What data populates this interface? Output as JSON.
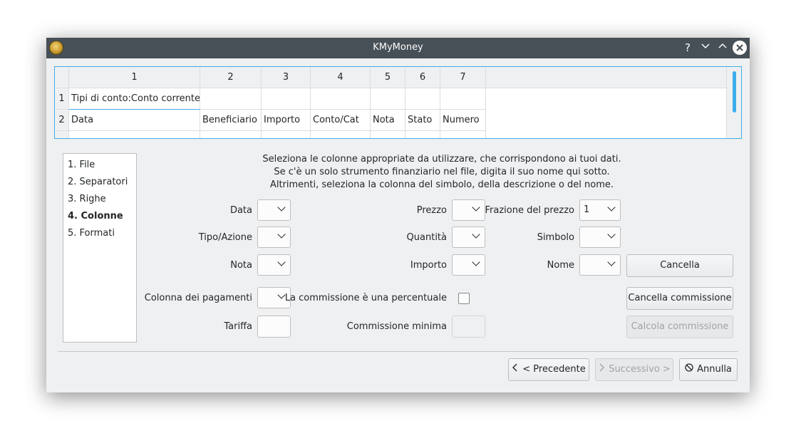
{
  "window": {
    "title": "KMyMoney"
  },
  "titlebar": {
    "help": "?",
    "minimize": "⌄",
    "maximize": "⌃",
    "close": "✕"
  },
  "preview": {
    "col_headers": [
      "1",
      "2",
      "3",
      "4",
      "5",
      "6",
      "7"
    ],
    "rows": [
      {
        "num": "1",
        "cells": [
          "Tipi di conto:Conto corrente",
          "",
          "",
          "",
          "",
          "",
          ""
        ]
      },
      {
        "num": "2",
        "cells": [
          "Data",
          "Beneficiario",
          "Importo",
          "Conto/Cat",
          "Nota",
          "Stato",
          "Numero"
        ]
      }
    ]
  },
  "steps": {
    "items": [
      "1. File",
      "2. Separatori",
      "3. Righe",
      "4. Colonne",
      "5. Formati"
    ],
    "active_index": 3
  },
  "info": {
    "line1": "Seleziona le colonne appropriate da utilizzare, che corrispondono ai tuoi dati.",
    "line2": "Se c'è un solo strumento finanziario nel file, digita il suo nome qui sotto.",
    "line3": "Altrimenti, seleziona la colonna del simbolo, della descrizione o del nome."
  },
  "form": {
    "data_label": "Data",
    "tipo_label": "Tipo/Azione",
    "nota_label": "Nota",
    "colonna_pagamenti_label": "Colonna dei pagamenti",
    "tariffa_label": "Tariffa",
    "prezzo_label": "Prezzo",
    "quantita_label": "Quantità",
    "importo_label": "Importo",
    "percentuale_label": "La commissione è una percentuale",
    "commissione_minima_label": "Commissione minima",
    "frazione_label": "Frazione del prezzo",
    "frazione_value": "1",
    "simbolo_label": "Simbolo",
    "nome_label": "Nome",
    "cancella_label": "Cancella",
    "cancella_commissione_label": "Cancella commissione",
    "calcola_commissione_label": "Calcola commissione"
  },
  "footer": {
    "precedente_label": "< Precedente",
    "successivo_label": "Successivo >",
    "annulla_label": "Annulla"
  }
}
